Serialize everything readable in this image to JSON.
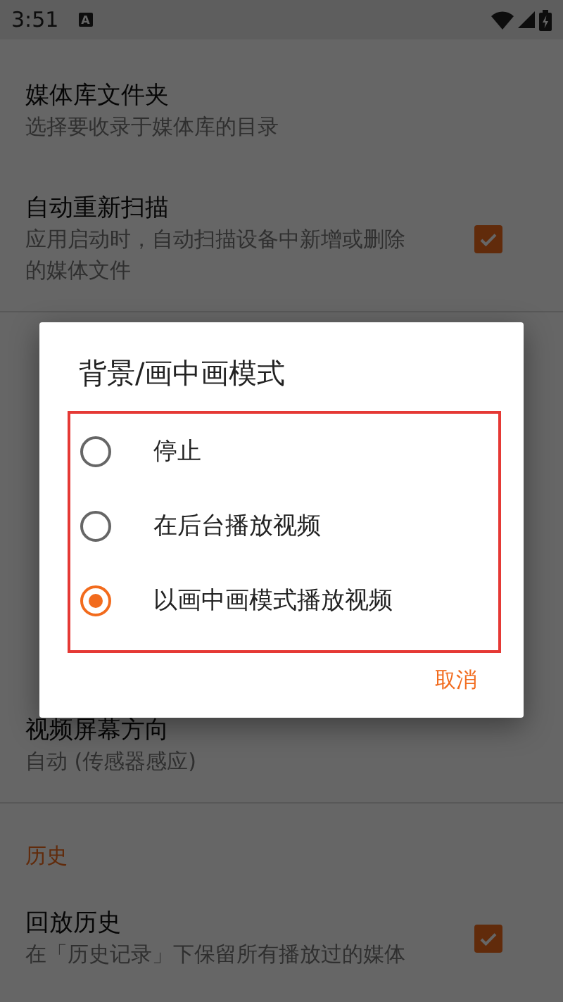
{
  "status_bar": {
    "time": "3:51",
    "notification": "A"
  },
  "sections": [
    {
      "items": [
        {
          "title": "媒体库文件夹",
          "subtitle_lines": [
            "选择要收录于媒体库的目录"
          ]
        },
        {
          "title": "自动重新扫描",
          "subtitle_lines": [
            "应用启动时，自动扫描设备中新增或删除的媒体文件"
          ],
          "checked": true
        }
      ]
    },
    {
      "items": [
        {
          "title": "视频屏幕方向",
          "subtitle_lines": [
            "自动 (传感器感应)"
          ]
        }
      ]
    },
    {
      "header": "历史",
      "items": [
        {
          "title": "回放历史",
          "subtitle_lines": [
            "在「历史记录」下保留所有播放过的媒体"
          ],
          "checked": true
        }
      ]
    }
  ],
  "dialog": {
    "title": "背景/画中画模式",
    "options_highlighted": true,
    "options": [
      {
        "label": "停止",
        "selected": false
      },
      {
        "label": "在后台播放视频",
        "selected": false
      },
      {
        "label": "以画中画模式播放视频",
        "selected": true
      }
    ],
    "buttons": [
      "取消"
    ]
  }
}
